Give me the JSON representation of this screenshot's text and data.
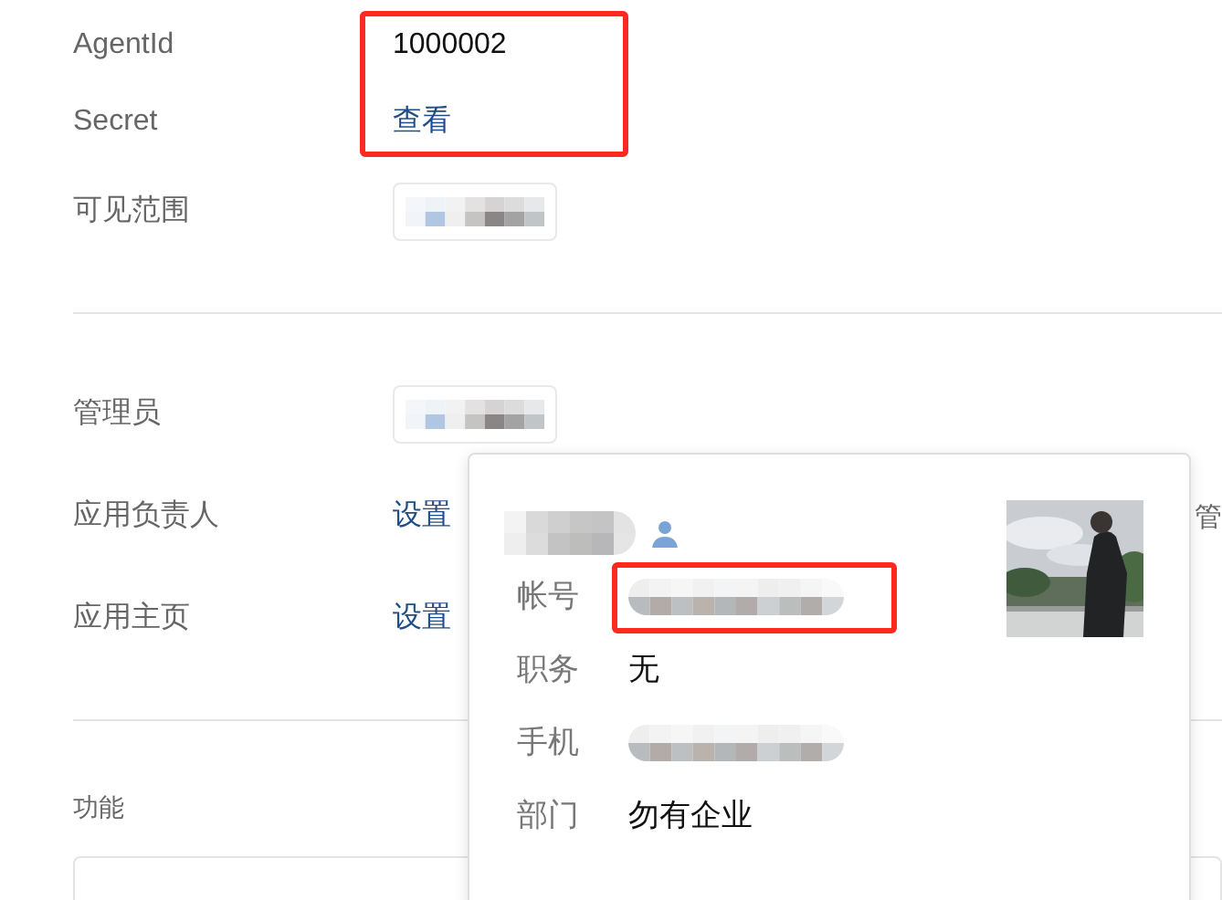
{
  "fields": [
    {
      "label": "AgentId",
      "kind": "text",
      "value": "1000002",
      "highlighted": true
    },
    {
      "label": "Secret",
      "kind": "link",
      "value": "查看",
      "highlighted": true
    },
    {
      "label": "可见范围",
      "kind": "masked",
      "highlighted": false
    }
  ],
  "managers": [
    {
      "label": "管理员",
      "kind": "masked"
    },
    {
      "label": "应用负责人",
      "kind": "link",
      "value": "设置",
      "trailing": "管"
    },
    {
      "label": "应用主页",
      "kind": "link",
      "value": "设置"
    }
  ],
  "section": {
    "title": "功能"
  },
  "popup": {
    "name": {
      "kind": "masked"
    },
    "rows": [
      {
        "label": "帐号",
        "kind": "masked",
        "highlighted": true
      },
      {
        "label": "职务",
        "kind": "text",
        "value": "无",
        "highlighted": false
      },
      {
        "label": "手机",
        "kind": "masked",
        "highlighted": false
      },
      {
        "label": "部门",
        "kind": "text",
        "value": "勿有企业",
        "highlighted": false
      }
    ]
  }
}
